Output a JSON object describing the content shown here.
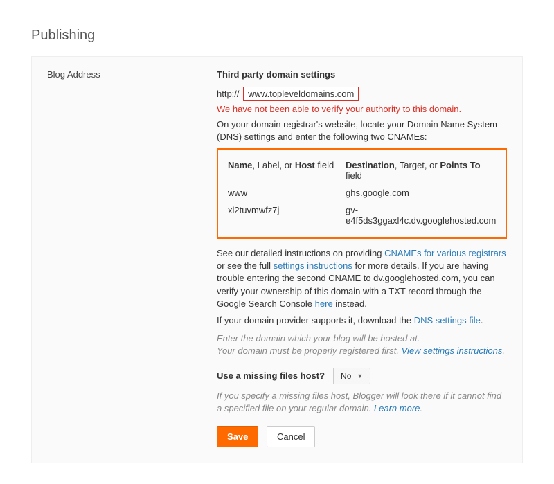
{
  "page_title": "Publishing",
  "left_label": "Blog Address",
  "heading": "Third party domain settings",
  "url_prefix": "http://",
  "domain_value": "www.topleveldomains.com",
  "error_msg": "We have not been able to verify your authority to this domain.",
  "instr_line1": "On your domain registrar's website, locate your Domain Name System (DNS) settings and enter the following two CNAMEs:",
  "cname": {
    "header_name_pre": "Name",
    "header_name_mid": ", Label",
    "header_name_post": ", or ",
    "header_name_bold2": "Host",
    "header_name_suffix": " field",
    "header_dest_pre": "Destination",
    "header_dest_mid": ", Target",
    "header_dest_post": ", or ",
    "header_dest_bold2": "Points To",
    "header_dest_suffix": " field",
    "rows": [
      {
        "name": "www",
        "dest": "ghs.google.com"
      },
      {
        "name": "xl2tuvmwfz7j",
        "dest": "gv-e4f5ds3ggaxl4c.dv.googlehosted.com"
      }
    ]
  },
  "details": {
    "p1a": "See our detailed instructions on providing ",
    "p1_link1": "CNAMEs for various registrars",
    "p1b": " or see the full ",
    "p1_link2": "settings instructions",
    "p1c": " for more details. If you are having trouble entering the second CNAME to dv.googlehosted.com, you can verify your ownership of this domain with a TXT record through the Google Search Console ",
    "p1_link3": "here",
    "p1d": " instead.",
    "p2a": "If your domain provider supports it, download the ",
    "p2_link": "DNS settings file",
    "p2b": "."
  },
  "hint1a": "Enter the domain which your blog will be hosted at.",
  "hint1b": "Your domain must be properly registered first. ",
  "hint1_link": "View settings instructions",
  "hint1c": ".",
  "missing_label": "Use a missing files host?",
  "missing_value": "No",
  "hint2a": "If you specify a missing files host, Blogger will look there if it cannot find a specified file on your regular domain. ",
  "hint2_link": "Learn more",
  "hint2b": ".",
  "save_label": "Save",
  "cancel_label": "Cancel"
}
